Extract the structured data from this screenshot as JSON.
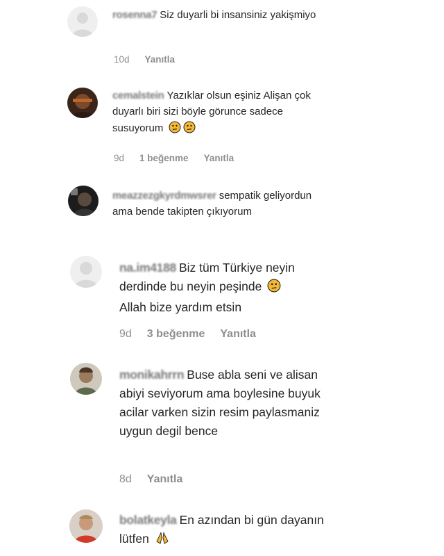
{
  "comments": [
    {
      "username": "rosenna7",
      "text": "Siz duyarli bi insansiniz yakişmiyo",
      "time": "10d",
      "likes": "",
      "reply": "Yanıtla",
      "emoji": ""
    },
    {
      "username": "cemalstein",
      "text": "Yazıklar olsun eşiniz Alişan çok duyarlı biri sizi böyle görunce sadece susuyorum",
      "time": "9d",
      "likes": "1 beğenme",
      "reply": "Yanıtla",
      "emoji": "thinking-face-icon x2"
    },
    {
      "username": "meazzezgkyrdmwsrer",
      "text": "sempatik geliyordun ama bende takipten çıkıyorum",
      "time": "",
      "likes": "",
      "reply": "",
      "emoji": ""
    },
    {
      "username": "na.im4188",
      "text": "Biz tüm Türkiye neyin derdinde bu neyin peşinde",
      "text2": "Allah bize yardım etsin",
      "time": "9d",
      "likes": "3 beğenme",
      "reply": "Yanıtla",
      "emoji": "thinking-face-icon"
    },
    {
      "username": "monikahrrn",
      "text": "Buse abla seni ve alisan abiyi seviyorum ama boylesine buyuk acilar varken sizin resim paylasmaniz uygun degil bence",
      "time": "8d",
      "likes": "",
      "reply": "Yanıtla",
      "emoji": ""
    },
    {
      "username": "bolatkeyla",
      "text": "En azından bi gün dayanın lütfen",
      "time": "",
      "likes": "",
      "reply": "",
      "emoji": "folded-hands-icon"
    }
  ],
  "colors": {
    "text": "#262626",
    "meta": "#8e8e8e",
    "username": "#7a7a7a",
    "emoji": "#f5b833"
  }
}
